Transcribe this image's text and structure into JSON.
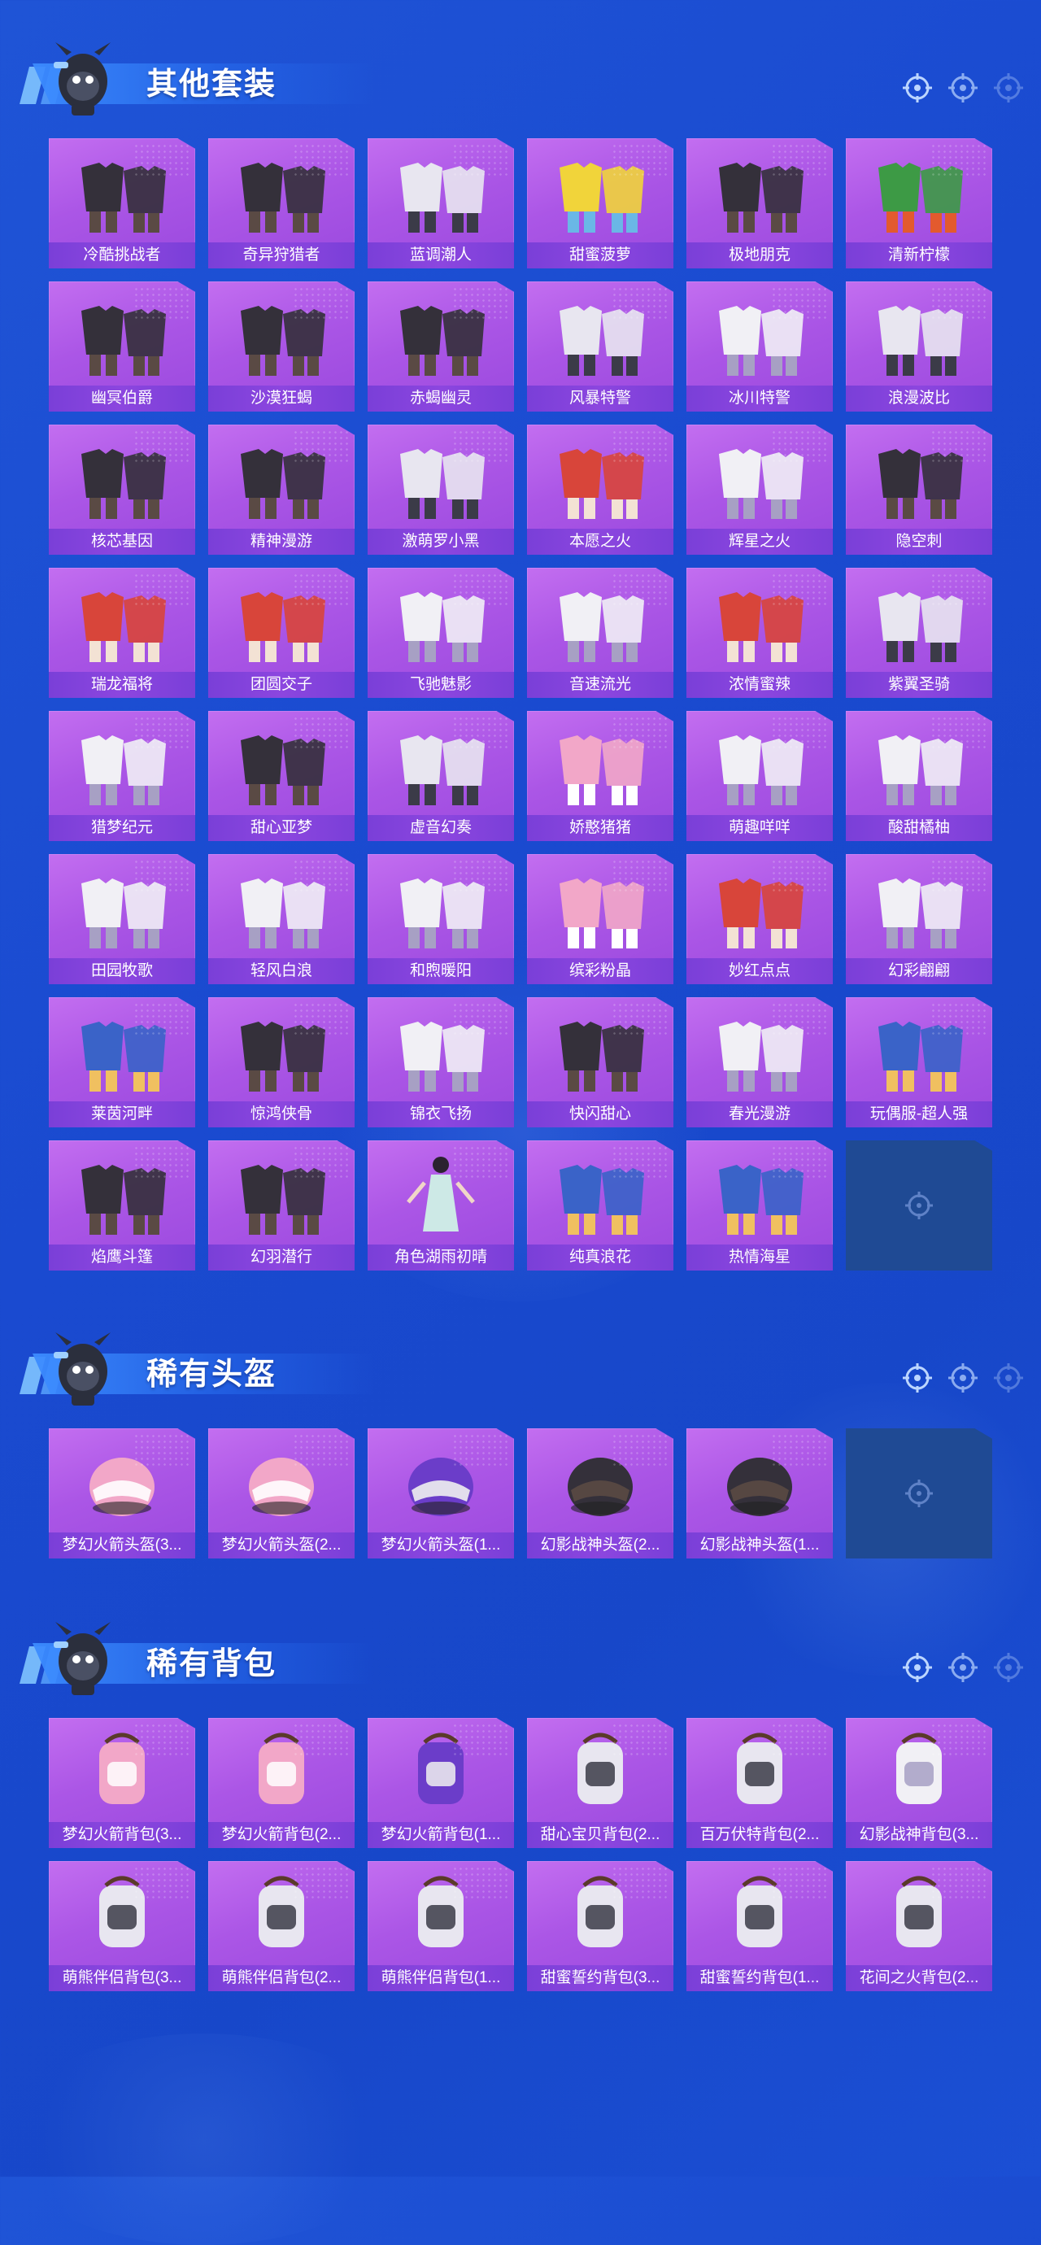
{
  "colors": {
    "background": "#1b4dd2",
    "card_fill": "#b35fe8",
    "card_label_bar": "#7e41da",
    "empty_slot": "#1f4a94",
    "title_text": "#ffffff"
  },
  "sections": [
    {
      "title": "其他套装",
      "items": [
        {
          "label": "冷酷挑战者",
          "icon": "dark-outfit-icon"
        },
        {
          "label": "奇异狩猎者",
          "icon": "dark-outfit-icon"
        },
        {
          "label": "蓝调潮人",
          "icon": "outfit-icon"
        },
        {
          "label": "甜蜜菠萝",
          "icon": "yellow-outfit-icon"
        },
        {
          "label": "极地朋克",
          "icon": "dark-outfit-icon"
        },
        {
          "label": "清新柠檬",
          "icon": "green-outfit-icon"
        },
        {
          "label": "幽冥伯爵",
          "icon": "dark-outfit-icon"
        },
        {
          "label": "沙漠狂蝎",
          "icon": "dark-outfit-icon"
        },
        {
          "label": "赤蝎幽灵",
          "icon": "dark-outfit-icon"
        },
        {
          "label": "风暴特警",
          "icon": "outfit-icon"
        },
        {
          "label": "冰川特警",
          "icon": "white-outfit-icon"
        },
        {
          "label": "浪漫波比",
          "icon": "outfit-icon"
        },
        {
          "label": "核芯基因",
          "icon": "dark-outfit-icon"
        },
        {
          "label": "精神漫游",
          "icon": "dark-outfit-icon"
        },
        {
          "label": "激萌罗小黑",
          "icon": "outfit-icon"
        },
        {
          "label": "本愿之火",
          "icon": "red-outfit-icon"
        },
        {
          "label": "辉星之火",
          "icon": "white-outfit-icon"
        },
        {
          "label": "隐空刺",
          "icon": "dark-outfit-icon"
        },
        {
          "label": "瑞龙福将",
          "icon": "red-outfit-icon"
        },
        {
          "label": "团圆交子",
          "icon": "red-outfit-icon"
        },
        {
          "label": "飞驰魅影",
          "icon": "white-outfit-icon"
        },
        {
          "label": "音速流光",
          "icon": "white-outfit-icon"
        },
        {
          "label": "浓情蜜辣",
          "icon": "red-outfit-icon"
        },
        {
          "label": "紫翼圣骑",
          "icon": "outfit-icon"
        },
        {
          "label": "猎梦纪元",
          "icon": "white-outfit-icon"
        },
        {
          "label": "甜心亚梦",
          "icon": "dark-outfit-icon"
        },
        {
          "label": "虚音幻奏",
          "icon": "outfit-icon"
        },
        {
          "label": "娇憨猪猪",
          "icon": "pink-outfit-icon"
        },
        {
          "label": "萌趣咩咩",
          "icon": "white-outfit-icon"
        },
        {
          "label": "酸甜橘柚",
          "icon": "white-outfit-icon"
        },
        {
          "label": "田园牧歌",
          "icon": "white-outfit-icon"
        },
        {
          "label": "轻风白浪",
          "icon": "white-outfit-icon"
        },
        {
          "label": "和煦暖阳",
          "icon": "white-outfit-icon"
        },
        {
          "label": "缤彩粉晶",
          "icon": "pink-outfit-icon"
        },
        {
          "label": "妙红点点",
          "icon": "red-outfit-icon"
        },
        {
          "label": "幻彩翩翩",
          "icon": "white-outfit-icon"
        },
        {
          "label": "莱茵河畔",
          "icon": "blue-outfit-icon"
        },
        {
          "label": "惊鸿侠骨",
          "icon": "dark-outfit-icon"
        },
        {
          "label": "锦衣飞扬",
          "icon": "white-outfit-icon"
        },
        {
          "label": "快闪甜心",
          "icon": "dark-outfit-icon"
        },
        {
          "label": "春光漫游",
          "icon": "white-outfit-icon"
        },
        {
          "label": "玩偶服-超人强",
          "icon": "blue-outfit-icon"
        },
        {
          "label": "焰鹰斗篷",
          "icon": "dark-outfit-icon"
        },
        {
          "label": "幻羽潜行",
          "icon": "dark-outfit-icon"
        },
        {
          "label": "角色湖雨初晴",
          "icon": "character-icon"
        },
        {
          "label": "纯真浪花",
          "icon": "blue-outfit-icon"
        },
        {
          "label": "热情海星",
          "icon": "blue-outfit-icon"
        }
      ]
    },
    {
      "title": "稀有头盔",
      "items": [
        {
          "label": "梦幻火箭头盔(3...",
          "icon": "pink-helmet-icon"
        },
        {
          "label": "梦幻火箭头盔(2...",
          "icon": "pink-helmet-icon"
        },
        {
          "label": "梦幻火箭头盔(1...",
          "icon": "purple-helmet-icon"
        },
        {
          "label": "幻影战神头盔(2...",
          "icon": "dark-helmet-icon"
        },
        {
          "label": "幻影战神头盔(1...",
          "icon": "dark-helmet-icon"
        }
      ]
    },
    {
      "title": "稀有背包",
      "items": [
        {
          "label": "梦幻火箭背包(3...",
          "icon": "pink-backpack-icon"
        },
        {
          "label": "梦幻火箭背包(2...",
          "icon": "pink-backpack-icon"
        },
        {
          "label": "梦幻火箭背包(1...",
          "icon": "purple-backpack-icon"
        },
        {
          "label": "甜心宝贝背包(2...",
          "icon": "icecream-backpack-icon"
        },
        {
          "label": "百万伏特背包(2...",
          "icon": "cat-backpack-icon"
        },
        {
          "label": "幻影战神背包(3...",
          "icon": "white-backpack-icon"
        },
        {
          "label": "萌熊伴侣背包(3...",
          "icon": "bear-backpack-icon"
        },
        {
          "label": "萌熊伴侣背包(2...",
          "icon": "bear-backpack-icon"
        },
        {
          "label": "萌熊伴侣背包(1...",
          "icon": "bear-backpack-icon"
        },
        {
          "label": "甜蜜誓约背包(3...",
          "icon": "heart-backpack-icon"
        },
        {
          "label": "甜蜜誓约背包(1...",
          "icon": "heart-backpack-icon"
        },
        {
          "label": "花间之火背包(2...",
          "icon": "floral-backpack-icon"
        }
      ]
    }
  ]
}
